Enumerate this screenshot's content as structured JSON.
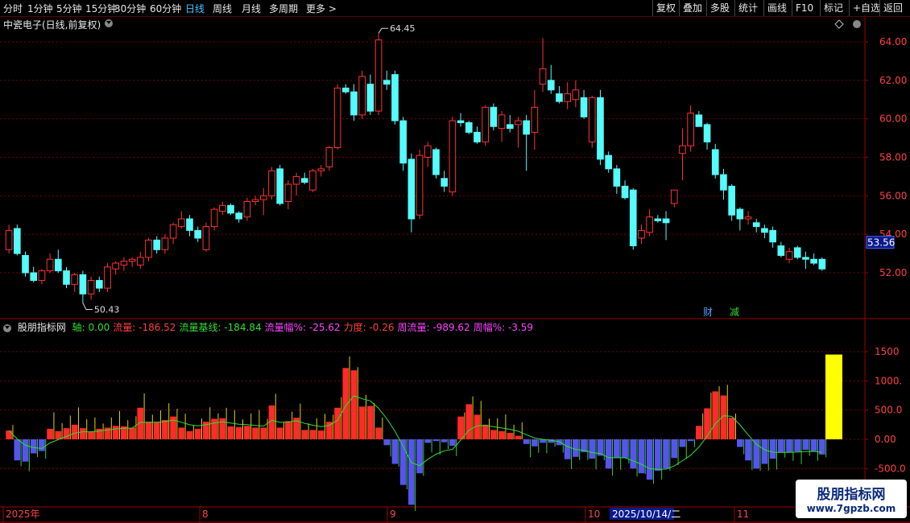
{
  "toolbar": {
    "periods": [
      "分时",
      "1分钟",
      "5分钟",
      "15分钟",
      "30分钟",
      "60分钟",
      "日线",
      "周线",
      "月线",
      "多周期",
      "更多 >"
    ],
    "active": "日线",
    "right_buttons": [
      "复权",
      "叠加",
      "多股",
      "统计",
      "画线",
      "F10",
      "标记",
      "+自选",
      "返回"
    ]
  },
  "stock": {
    "title": "中瓷电子(日线,前复权)"
  },
  "price_axis": {
    "ticks": [
      "64.00",
      "62.00",
      "60.00",
      "58.00",
      "56.00",
      "54.00",
      "52.00"
    ],
    "current": "53.56"
  },
  "annotations": {
    "high": "64.45",
    "low": "50.43",
    "cai": "财",
    "jian": "减"
  },
  "indicator": {
    "name": "股朋指标网",
    "items": [
      {
        "text": "轴: 0.00",
        "color": "#33dd33"
      },
      {
        "text": "流量: -186.52",
        "color": "#ff4040"
      },
      {
        "text": "流量基线: -184.84",
        "color": "#33dd33"
      },
      {
        "text": "流量幅%: -25.62",
        "color": "#ff44ff"
      },
      {
        "text": "力度: -0.26",
        "color": "#ff4040"
      },
      {
        "text": "周流量: -989.62",
        "color": "#ff44ff"
      },
      {
        "text": "周幅%: -3.59",
        "color": "#ff44ff"
      }
    ],
    "ticks": [
      "1500",
      "1000.",
      "500.0",
      "0.00",
      "-500.0"
    ]
  },
  "date_axis": {
    "labels": [
      "2025年",
      "8",
      "9",
      "10",
      "11"
    ],
    "highlight": "2025/10/14/二"
  },
  "colors": {
    "up": "#ff3232",
    "down": "#54fcfc",
    "grid": "#7a0000",
    "axis": "#a00000"
  },
  "watermark": {
    "main": "股朋指标网",
    "url": "www.7gpzb.com"
  },
  "chart_data": {
    "type": "candlestick",
    "candles": [
      [
        53.2,
        54.5,
        53.0,
        54.2
      ],
      [
        54.3,
        54.5,
        52.9,
        53.0
      ],
      [
        52.9,
        53.1,
        51.8,
        52.0
      ],
      [
        52.0,
        52.3,
        51.5,
        51.6
      ],
      [
        51.6,
        52.2,
        51.4,
        52.1
      ],
      [
        52.1,
        53.0,
        52.0,
        52.7
      ],
      [
        52.7,
        53.2,
        52.0,
        52.1
      ],
      [
        52.1,
        52.3,
        51.2,
        51.4
      ],
      [
        51.4,
        52.0,
        51.0,
        51.9
      ],
      [
        51.9,
        52.1,
        50.4,
        50.9
      ],
      [
        50.9,
        51.8,
        50.6,
        51.6
      ],
      [
        51.6,
        51.8,
        51.0,
        51.2
      ],
      [
        51.2,
        52.5,
        51.0,
        52.3
      ],
      [
        52.2,
        52.6,
        51.9,
        52.5
      ],
      [
        52.4,
        52.8,
        52.1,
        52.6
      ],
      [
        52.6,
        52.8,
        52.3,
        52.7
      ],
      [
        52.4,
        53.1,
        52.2,
        52.8
      ],
      [
        52.8,
        53.8,
        52.6,
        53.7
      ],
      [
        53.7,
        53.9,
        53.0,
        53.2
      ],
      [
        53.2,
        54.0,
        53.0,
        53.8
      ],
      [
        53.8,
        54.6,
        53.5,
        54.5
      ],
      [
        54.4,
        55.2,
        54.3,
        54.8
      ],
      [
        54.8,
        55.0,
        53.9,
        54.2
      ],
      [
        54.2,
        54.4,
        53.6,
        53.8
      ],
      [
        53.2,
        54.6,
        53.1,
        54.4
      ],
      [
        54.4,
        55.4,
        54.2,
        55.3
      ],
      [
        55.2,
        55.7,
        55.0,
        55.5
      ],
      [
        55.5,
        55.6,
        55.0,
        55.1
      ],
      [
        55.1,
        55.2,
        54.6,
        54.8
      ],
      [
        54.9,
        55.9,
        54.7,
        55.7
      ],
      [
        55.7,
        56.0,
        55.5,
        55.8
      ],
      [
        55.8,
        56.4,
        55.0,
        56.0
      ],
      [
        56.0,
        57.5,
        55.8,
        57.3
      ],
      [
        57.4,
        57.6,
        55.5,
        55.6
      ],
      [
        55.7,
        56.8,
        55.3,
        56.6
      ],
      [
        56.6,
        57.2,
        56.0,
        57.0
      ],
      [
        56.9,
        57.2,
        56.6,
        56.7
      ],
      [
        56.3,
        57.4,
        56.2,
        57.3
      ],
      [
        57.3,
        57.6,
        57.0,
        57.4
      ],
      [
        57.5,
        58.6,
        57.3,
        58.5
      ],
      [
        58.5,
        61.8,
        58.4,
        61.6
      ],
      [
        61.6,
        61.8,
        61.3,
        61.4
      ],
      [
        61.4,
        61.8,
        59.9,
        60.2
      ],
      [
        60.2,
        62.5,
        60.0,
        62.2
      ],
      [
        61.8,
        62.3,
        60.2,
        60.4
      ],
      [
        60.4,
        64.45,
        60.2,
        64.1
      ],
      [
        62.0,
        62.5,
        61.5,
        61.8
      ],
      [
        62.3,
        62.5,
        59.7,
        59.9
      ],
      [
        59.9,
        60.1,
        57.3,
        57.7
      ],
      [
        57.9,
        58.2,
        54.1,
        54.8
      ],
      [
        55.0,
        58.4,
        54.8,
        58.1
      ],
      [
        58.0,
        58.8,
        57.5,
        58.6
      ],
      [
        58.4,
        58.5,
        56.9,
        57.1
      ],
      [
        56.9,
        57.3,
        56.2,
        56.5
      ],
      [
        56.2,
        60.1,
        56.0,
        59.9
      ],
      [
        59.9,
        60.3,
        59.6,
        59.8
      ],
      [
        59.8,
        59.9,
        59.2,
        59.3
      ],
      [
        59.3,
        59.6,
        58.7,
        58.8
      ],
      [
        58.8,
        60.7,
        58.6,
        60.6
      ],
      [
        60.6,
        60.8,
        59.4,
        59.6
      ],
      [
        59.5,
        60.4,
        58.8,
        60.2
      ],
      [
        59.7,
        60.2,
        59.3,
        59.5
      ],
      [
        59.7,
        60.1,
        58.5,
        59.9
      ],
      [
        59.9,
        60.2,
        57.3,
        59.2
      ],
      [
        59.3,
        61.5,
        58.4,
        60.6
      ],
      [
        61.8,
        64.2,
        61.4,
        62.6
      ],
      [
        62.0,
        62.8,
        61.3,
        61.5
      ],
      [
        61.3,
        61.7,
        60.8,
        60.9
      ],
      [
        60.9,
        61.9,
        60.5,
        61.3
      ],
      [
        61.0,
        62.0,
        60.6,
        61.5
      ],
      [
        61.1,
        61.5,
        60.0,
        60.1
      ],
      [
        58.8,
        61.2,
        58.5,
        61.1
      ],
      [
        61.1,
        61.5,
        57.6,
        57.9
      ],
      [
        58.1,
        58.3,
        57.2,
        57.4
      ],
      [
        57.4,
        57.6,
        56.1,
        56.5
      ],
      [
        56.5,
        56.8,
        55.8,
        55.9
      ],
      [
        56.3,
        56.4,
        53.2,
        53.4
      ],
      [
        53.8,
        54.5,
        53.5,
        54.2
      ],
      [
        54.1,
        55.3,
        53.9,
        54.9
      ],
      [
        54.8,
        55.0,
        54.6,
        54.7
      ],
      [
        54.8,
        55.2,
        53.7,
        54.6
      ],
      [
        55.6,
        56.3,
        55.4,
        56.3
      ],
      [
        58.2,
        59.5,
        56.8,
        58.6
      ],
      [
        58.6,
        60.7,
        58.3,
        60.3
      ],
      [
        60.2,
        60.4,
        59.6,
        59.6
      ],
      [
        59.7,
        59.8,
        58.4,
        58.8
      ],
      [
        58.4,
        58.7,
        56.9,
        57.1
      ],
      [
        57.1,
        57.4,
        55.8,
        56.3
      ],
      [
        56.5,
        56.6,
        54.7,
        55.0
      ],
      [
        55.3,
        55.4,
        54.2,
        54.8
      ],
      [
        54.8,
        55.2,
        54.5,
        54.9
      ],
      [
        54.6,
        54.8,
        54.1,
        54.4
      ],
      [
        54.3,
        54.5,
        53.8,
        54.1
      ],
      [
        54.2,
        54.4,
        53.3,
        53.6
      ],
      [
        53.4,
        53.6,
        52.8,
        52.9
      ],
      [
        52.7,
        53.3,
        52.5,
        53.1
      ],
      [
        53.3,
        53.4,
        52.7,
        52.8
      ],
      [
        52.8,
        53.1,
        52.2,
        52.7
      ],
      [
        52.7,
        53.0,
        52.4,
        52.5
      ],
      [
        52.7,
        52.8,
        52.1,
        52.2
      ]
    ],
    "flow": [
      150,
      -360,
      -380,
      -240,
      -200,
      180,
      140,
      190,
      250,
      190,
      130,
      180,
      200,
      230,
      220,
      200,
      540,
      300,
      290,
      330,
      390,
      200,
      140,
      180,
      300,
      350,
      360,
      220,
      210,
      230,
      200,
      200,
      580,
      200,
      310,
      370,
      160,
      160,
      150,
      300,
      540,
      1220,
      1180,
      560,
      570,
      200,
      -100,
      -420,
      -780,
      -1120,
      -580,
      -60,
      -30,
      -50,
      -110,
      390,
      600,
      420,
      250,
      160,
      140,
      110,
      60,
      -80,
      -120,
      -60,
      -60,
      -100,
      -340,
      -300,
      -220,
      -330,
      -280,
      -500,
      -320,
      -320,
      -500,
      -580,
      -690,
      -540,
      -500,
      -320,
      -130,
      -30,
      230,
      530,
      820,
      750,
      370,
      -130,
      -360,
      -500,
      -420,
      -330,
      -230,
      -220,
      -210,
      -180,
      -200,
      -260
    ]
  }
}
